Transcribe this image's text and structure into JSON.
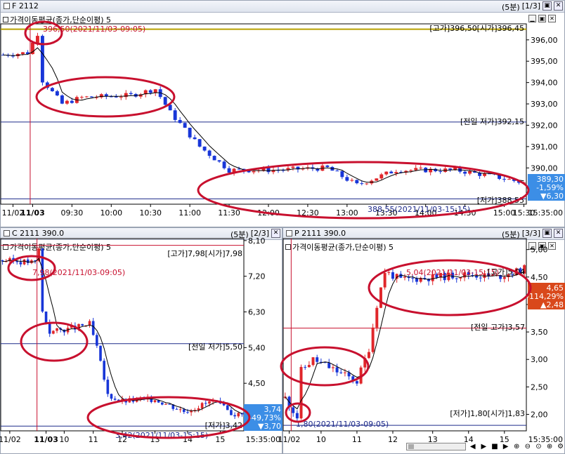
{
  "top": {
    "symbol": "F 2112",
    "period": "(5분)",
    "page": "[1/3]",
    "legend": "가격이동평균(종가,단순이평) 5",
    "high_note": "396,50(2021/11/03-09:05)",
    "high_open": "[고가]396,50[시가]396,45",
    "prev_low": "[전일 저가]392,15",
    "low_note": "388,55(2021/11/03-15:15)",
    "low_label": "[저가]388,55",
    "current": {
      "price": "389,30",
      "change": "-1,59%",
      "diff": "▼6,30"
    },
    "y_ticks": [
      "396,00",
      "395,00",
      "394,00",
      "393,00",
      "392,00",
      "391,00",
      "390,00"
    ],
    "x_ticks": [
      "11/02",
      "11/03",
      "09:30",
      "10:00",
      "10:30",
      "11:00",
      "11:30",
      "12:00",
      "12:30",
      "13:00",
      "13:30",
      "14:00",
      "14:30",
      "15:00",
      "15:30"
    ],
    "time": "15:35:00"
  },
  "bottom_left": {
    "symbol": "C 2111 390.0",
    "period": "(5분)",
    "page": "[2/3]",
    "legend": "가격이동평균(종가,단순이평) 5",
    "high_note": "7,98(2021/11/03-09:05)",
    "high_open": "[고가]7,98[시가]7,98",
    "prev_low": "[전일 저가]5,50",
    "low_note": "3,42(2021/11/03-15:15)",
    "low_label": "[저가]3,42",
    "current": {
      "price": "3,74",
      "change": "-49,73%",
      "diff": "▼3,70"
    },
    "y_ticks": [
      "8,10",
      "7,20",
      "6,30",
      "5,40",
      "4,50"
    ],
    "x_ticks": [
      "11/02",
      "11/03",
      "10",
      "11",
      "12",
      "13",
      "14",
      "15"
    ],
    "time": "15:35:00"
  },
  "bottom_right": {
    "symbol": "P 2111 390.0",
    "period": "(5분)",
    "page": "[3/3]",
    "legend": "가격이동평균(종가,단순이평) 5",
    "high_note": "5,04(2021/11/03-15:15)",
    "high_label": "[고가]5,04",
    "prev_high": "[전일 고가]3,57",
    "low_note": "1,80(2021/11/03-09:05)",
    "low_open": "[저가]1,80[시가]1,83",
    "current": {
      "price": "4,65",
      "change": "-114,29%",
      "diff": "▲2,48"
    },
    "y_ticks": [
      "5,00",
      "4,50",
      "4,00",
      "3,50",
      "3,00",
      "2,50",
      "2,00"
    ],
    "x_ticks": [
      "11/02",
      "10",
      "11",
      "12",
      "13",
      "14",
      "15"
    ],
    "time": "15:35:00"
  },
  "colors": {
    "up": "#e0262a",
    "down": "#1836d8",
    "highlight": "#c8102e",
    "ma": "#000000"
  }
}
